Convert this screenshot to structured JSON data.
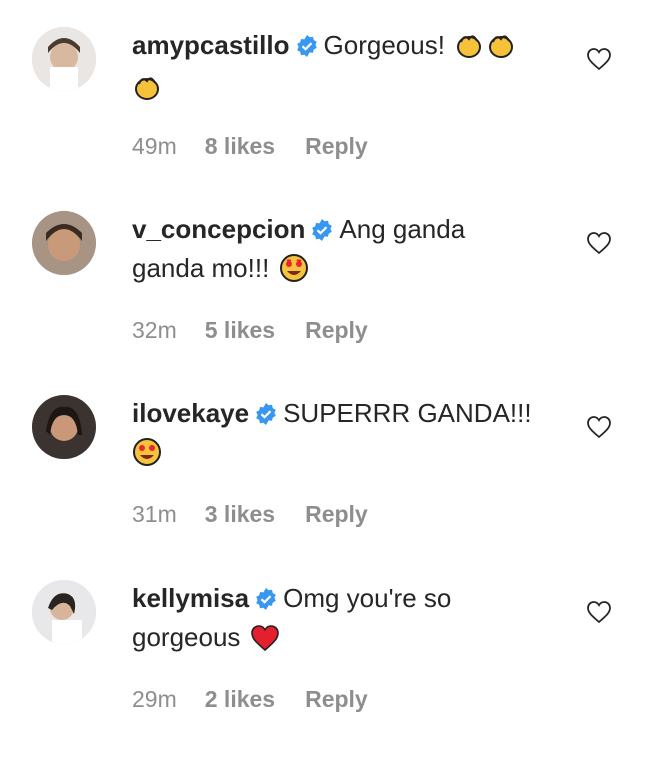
{
  "comments": [
    {
      "username": "amypcastillo",
      "text": "Gorgeous!",
      "emojis": [
        "clapping-hands",
        "clapping-hands",
        "clapping-hands"
      ],
      "time": "49m",
      "likes": "8 likes",
      "reply": "Reply"
    },
    {
      "username": "v_concepcion",
      "text": "Ang ganda ganda mo!!!",
      "emojis": [
        "heart-eyes-face"
      ],
      "time": "32m",
      "likes": "5 likes",
      "reply": "Reply"
    },
    {
      "username": "ilovekaye",
      "text": "SUPERRR GANDA!!!",
      "emojis": [
        "heart-eyes-face"
      ],
      "time": "31m",
      "likes": "3 likes",
      "reply": "Reply"
    },
    {
      "username": "kellymisa",
      "text": "Omg you're so gorgeous",
      "emojis": [
        "red-heart"
      ],
      "time": "29m",
      "likes": "2 likes",
      "reply": "Reply"
    }
  ],
  "colors": {
    "verified": "#3897f0",
    "muted": "#8e8e8e",
    "text": "#262626"
  }
}
